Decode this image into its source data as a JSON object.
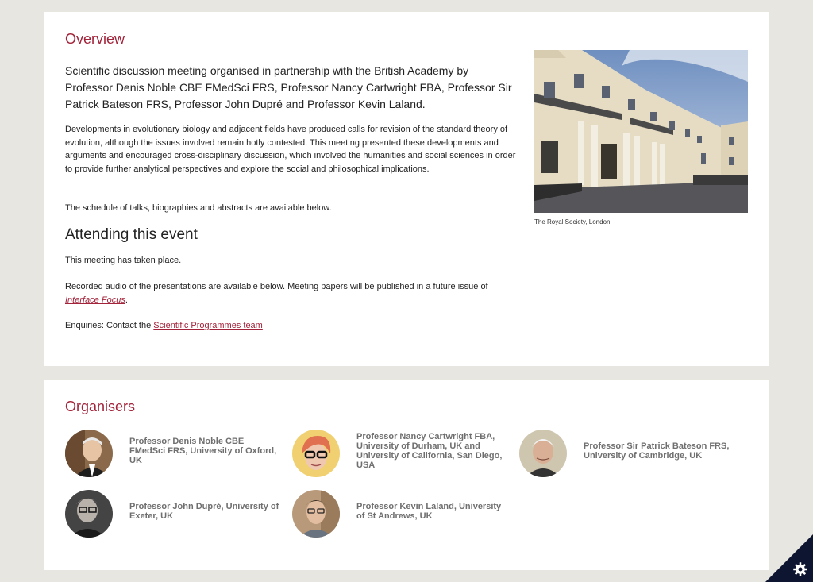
{
  "overview": {
    "heading": "Overview",
    "lead": "Scientific discussion meeting organised in partnership with the British Academy by Professor Denis Noble CBE FMedSci FRS, Professor Nancy Cartwright FBA, Professor Sir Patrick Bateson FRS, Professor John Dupré and Professor Kevin Laland.",
    "developments": "Developments in evolutionary biology and adjacent fields have produced calls for revision of the standard theory of evolution, although the issues involved remain hotly contested. This meeting presented these developments and arguments and encouraged cross-disciplinary discussion, which involved the humanities and social sciences in order to provide further analytical perspectives and explore the social and philosophical implications.",
    "schedule": "The schedule of talks, biographies and abstracts are available below.",
    "photo_caption": "The Royal Society, London"
  },
  "attending": {
    "heading": "Attending this event",
    "taken_place": "This meeting has taken place.",
    "recorded_prefix": "Recorded audio of the presentations are available below. Meeting papers will be published in a future issue of ",
    "journal_link": "Interface Focus",
    "recorded_suffix": ".",
    "enquiries_prefix": "Enquiries: Contact the ",
    "enquiries_link": "Scientific Programmes team"
  },
  "organisers": {
    "heading": "Organisers",
    "people": [
      {
        "name": "Professor Denis Noble CBE FMedSci FRS, University of Oxford, UK"
      },
      {
        "name": "Professor Nancy Cartwright FBA, University of Durham, UK and University of California, San Diego, USA"
      },
      {
        "name": "Professor Sir Patrick Bateson FRS, University of Cambridge, UK"
      },
      {
        "name": "Professor John Dupré, University of Exeter, UK"
      },
      {
        "name": "Professor Kevin Laland, University of St Andrews, UK"
      }
    ]
  },
  "colors": {
    "accent": "#a3233a",
    "page_bg": "#e8e6e1",
    "card_bg": "#ffffff",
    "organiser_name": "#6f6f6f",
    "badge": "#0d1530"
  },
  "icons": {
    "settings": "gear-icon"
  }
}
